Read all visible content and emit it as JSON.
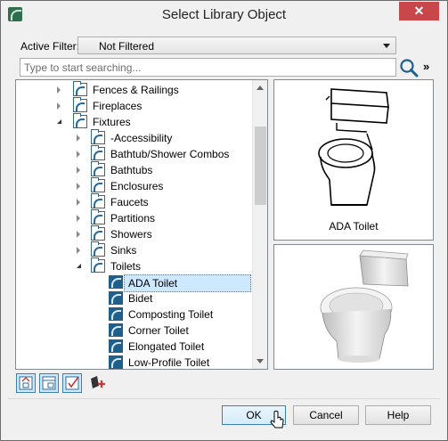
{
  "window": {
    "title": "Select Library Object",
    "close_glyph": "✕"
  },
  "filter": {
    "label": "Active Filter:",
    "value": "Not Filtered"
  },
  "search": {
    "placeholder": "Type to start searching...",
    "more_glyph": "»"
  },
  "tree": {
    "folders": [
      {
        "label": "Fences & Railings",
        "expanded": false,
        "level": 0
      },
      {
        "label": "Fireplaces",
        "expanded": false,
        "level": 0
      },
      {
        "label": "Fixtures",
        "expanded": true,
        "level": 0
      },
      {
        "label": "-Accessibility",
        "expanded": false,
        "level": 1
      },
      {
        "label": "Bathtub/Shower Combos",
        "expanded": false,
        "level": 1
      },
      {
        "label": "Bathtubs",
        "expanded": false,
        "level": 1
      },
      {
        "label": "Enclosures",
        "expanded": false,
        "level": 1
      },
      {
        "label": "Faucets",
        "expanded": false,
        "level": 1
      },
      {
        "label": "Partitions",
        "expanded": false,
        "level": 1
      },
      {
        "label": "Showers",
        "expanded": false,
        "level": 1
      },
      {
        "label": "Sinks",
        "expanded": false,
        "level": 1
      },
      {
        "label": "Toilets",
        "expanded": true,
        "level": 1
      }
    ],
    "objects": [
      {
        "label": "ADA Toilet",
        "selected": true
      },
      {
        "label": "Bidet",
        "selected": false
      },
      {
        "label": "Composting Toilet",
        "selected": false
      },
      {
        "label": "Corner Toilet",
        "selected": false
      },
      {
        "label": "Elongated Toilet",
        "selected": false
      },
      {
        "label": "Low-Profile Toilet",
        "selected": false
      }
    ]
  },
  "preview": {
    "caption": "ADA Toilet"
  },
  "buttons": {
    "ok": "OK",
    "cancel": "Cancel",
    "help": "Help"
  },
  "colors": {
    "close_red": "#c7474a",
    "selection": "#cde8ff",
    "folder_blue": "#2d6a9a"
  }
}
